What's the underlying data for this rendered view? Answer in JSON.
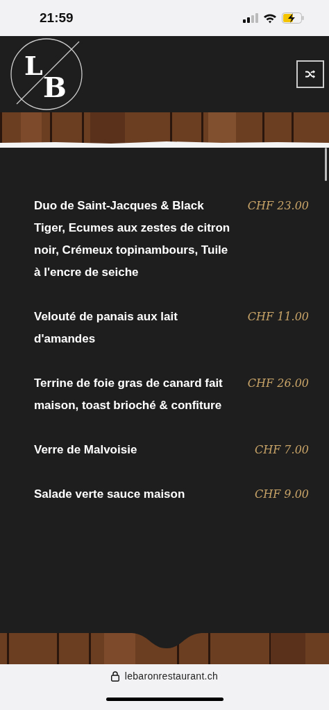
{
  "status_bar": {
    "time": "21:59"
  },
  "header": {
    "logo": {
      "first_letter": "L",
      "second_letter": "B"
    }
  },
  "menu_items": [
    {
      "name": "Duo de Saint-Jacques & Black Tiger, Ecumes aux zestes de citron noir, Crémeux topinambours, Tuile à l'encre de seiche",
      "price": "CHF 23.00"
    },
    {
      "name": "Velouté de panais aux lait d'amandes",
      "price": "CHF 11.00"
    },
    {
      "name": "Terrine de foie gras de canard fait maison, toast brioché & confiture",
      "price": "CHF 26.00"
    },
    {
      "name": "Verre de Malvoisie",
      "price": "CHF 7.00"
    },
    {
      "name": "Salade verte sauce maison",
      "price": "CHF 9.00"
    }
  ],
  "browser_bar": {
    "url": "lebaronrestaurant.ch"
  }
}
